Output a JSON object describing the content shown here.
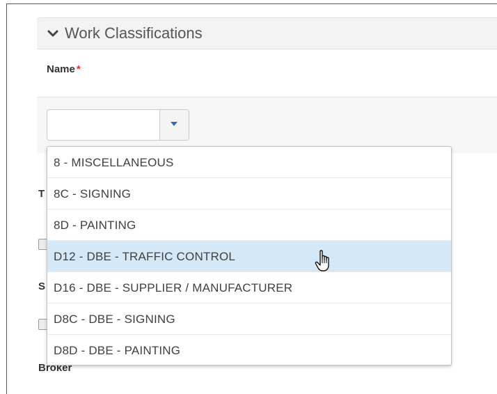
{
  "section": {
    "title": "Work Classifications",
    "toggle_icon": "chevron-down-icon"
  },
  "name_field": {
    "label": "Name",
    "required_marker": "*",
    "value": "",
    "dropdown_icon": "caret-down-icon"
  },
  "dropdown": {
    "options": [
      "8 - MISCELLANEOUS",
      "8C - SIGNING",
      "8D - PAINTING",
      "D12 - DBE - TRAFFIC CONTROL",
      "D16 - DBE - SUPPLIER / MANUFACTURER",
      "D8C - DBE - SIGNING",
      "D8D - DBE - PAINTING"
    ],
    "hovered": "D12 - DBE - TRAFFIC CONTROL"
  },
  "background": {
    "label_1_fragment": "T",
    "label_2_fragment": "S",
    "label_3": "Broker"
  },
  "colors": {
    "required": "#d9322f",
    "hover_row": "#d5e8f7",
    "caret": "#2a6db5"
  },
  "cursor_icon": "hand-pointer-icon"
}
